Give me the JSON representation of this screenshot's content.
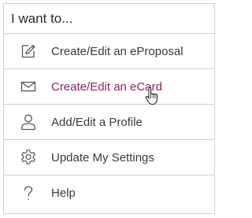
{
  "menu": {
    "header": "I want to...",
    "items": [
      {
        "label": "Create/Edit an eProposal",
        "icon": "pencil-square-icon",
        "hovered": false
      },
      {
        "label": "Create/Edit an eCard",
        "icon": "envelope-icon",
        "hovered": true
      },
      {
        "label": "Add/Edit a Profile",
        "icon": "person-icon",
        "hovered": false
      },
      {
        "label": "Update My Settings",
        "icon": "gear-icon",
        "hovered": false
      },
      {
        "label": "Help",
        "icon": "question-mark-icon",
        "hovered": false
      }
    ]
  },
  "colors": {
    "hover_text": "#8b2466",
    "text": "#3a3a3a",
    "border": "#cfcfcf",
    "icon": "#555555"
  }
}
